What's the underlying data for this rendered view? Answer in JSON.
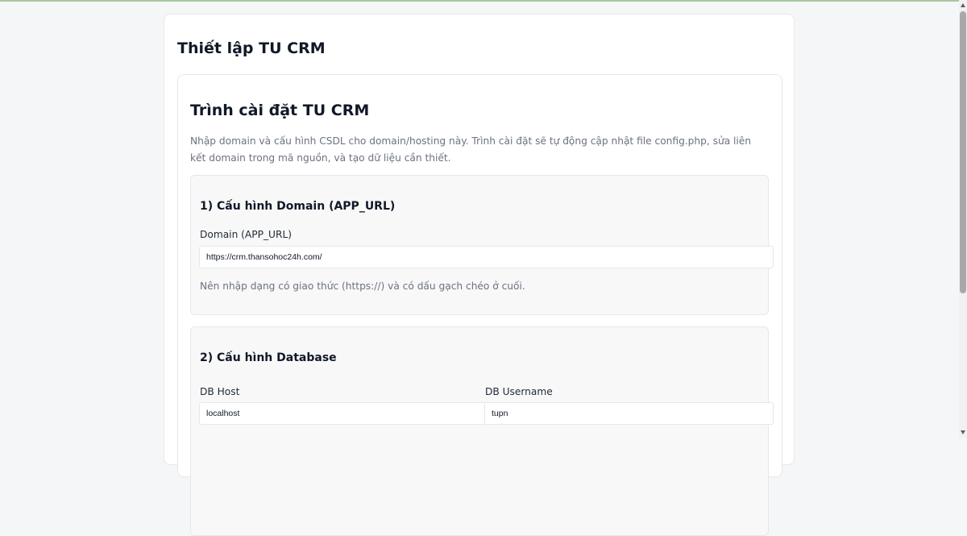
{
  "page": {
    "title": "Thiết lập TU CRM"
  },
  "installer": {
    "title": "Trình cài đặt TU CRM",
    "description": "Nhập domain và cấu hình CSDL cho domain/hosting này. Trình cài đặt sẽ tự động cập nhật file config.php, sửa liên kết domain trong mã nguồn, và tạo dữ liệu cần thiết."
  },
  "domain_section": {
    "title": "1) Cấu hình Domain (APP_URL)",
    "field_label": "Domain (APP_URL)",
    "field_value": "https://crm.thansohoc24h.com/",
    "hint": "Nên nhập dạng có giao thức (https://) và có dấu gạch chéo ở cuối."
  },
  "db_section": {
    "title": "2) Cấu hình Database",
    "host_label": "DB Host",
    "host_value": "localhost",
    "username_label": "DB Username",
    "username_value": "tupn"
  },
  "colors": {
    "accent_top": "#a7c7a0",
    "background": "#f5f6f7",
    "section_bg": "#f8f8f8"
  }
}
